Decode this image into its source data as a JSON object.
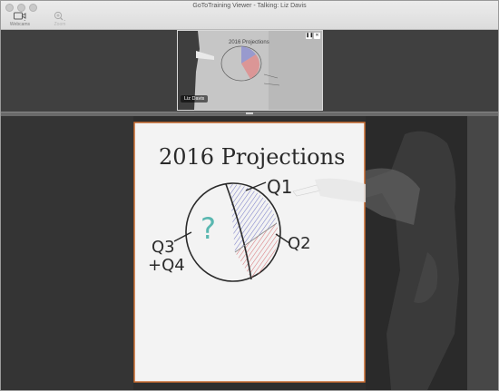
{
  "window": {
    "title": "GoToTraining Viewer - Talking: Liz Davis"
  },
  "toolbar": {
    "webcams_label": "Webcams",
    "zoom_label": "Zoom"
  },
  "thumbnail": {
    "presenter_name": "Liz Davis",
    "whiteboard_title": "2016 Projections"
  },
  "whiteboard": {
    "title": "2016 Projections",
    "labels": {
      "q1": "Q1",
      "q2": "Q2",
      "q3": "Q3",
      "q4": "+Q4",
      "unknown": "?"
    }
  },
  "colors": {
    "q1_hatch": "#7c7fc9",
    "q2_hatch": "#d9797c",
    "unknown_mark": "#59b7b0",
    "board_border": "#c86a2e"
  }
}
